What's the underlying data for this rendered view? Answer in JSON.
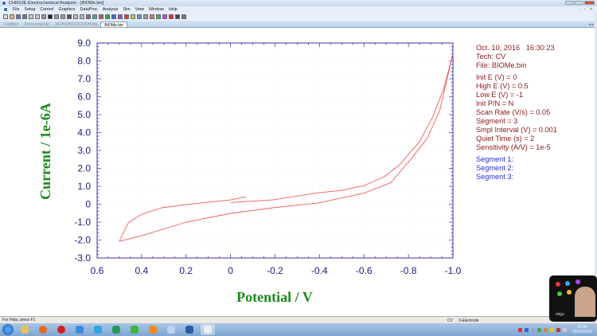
{
  "window": {
    "title": "CHI610E Electrochemical Analyzer - [BIOMe.bin]"
  },
  "menu": [
    "File",
    "Setup",
    "Control",
    "Graphics",
    "DataProc",
    "Analysis",
    "Sim",
    "View",
    "Window",
    "Help"
  ],
  "tabs": [
    {
      "label": "Untitled",
      "active": false
    },
    {
      "label": "Ferrocene.bin",
      "active": false
    },
    {
      "label": "(4-Ph)PhCF2COOH.bin",
      "active": false
    },
    {
      "label": "BIOMe.bin",
      "active": true
    }
  ],
  "info": {
    "datetime": "Oct. 10, 2016   16:30:23",
    "tech": "Tech: CV",
    "file": "File: BIOMe.bin",
    "params": [
      "Init E (V) = 0",
      "High E (V) = 0.5",
      "Low E (V) = -1",
      "Init P/N = N",
      "Scan Rate (V/s) = 0.05",
      "Segment = 3",
      "Smpl Interval (V) = 0.001",
      "Quiet Time (s) = 2",
      "Sensitivity (A/V) = 1e-5"
    ],
    "segments": [
      "Segment 1:",
      "Segment 2:",
      "Segment 3:"
    ]
  },
  "status": {
    "help": "For Help, press F1",
    "tech": "CV",
    "electrode": "3-Electrode"
  },
  "taskbar": {
    "time": "19:44",
    "date": "2016/10/10",
    "ad_brand": "migu"
  },
  "colors": {
    "axis": "#3333aa",
    "curve": "#f05a5a",
    "label": "#1a8a1a",
    "info": "#8b1a1a",
    "segment": "#2a2ae0"
  },
  "chart_data": {
    "type": "line",
    "xlabel": "Potential / V",
    "ylabel": "Current / 1e-6A",
    "xlim": [
      0.6,
      -1.0
    ],
    "ylim": [
      -3.0,
      9.0
    ],
    "xticks": [
      "0.6",
      "0.4",
      "0.2",
      "0",
      "-0.2",
      "-0.4",
      "-0.6",
      "-0.8",
      "-1.0"
    ],
    "yticks": [
      "9.0",
      "8.0",
      "7.0",
      "6.0",
      "5.0",
      "4.0",
      "3.0",
      "2.0",
      "1.0",
      "0",
      "-1.0",
      "-2.0",
      "-3.0"
    ],
    "grid": true,
    "series": [
      {
        "name": "Segment 1",
        "x": [
          0,
          -0.19,
          -0.395,
          -0.5,
          -0.6,
          -0.69,
          -0.76,
          -0.85,
          -0.91,
          -0.96,
          -1.0
        ],
        "y": [
          0.1,
          0.24,
          0.64,
          0.77,
          1.04,
          1.53,
          2.2,
          3.5,
          4.9,
          6.5,
          8.4
        ]
      },
      {
        "name": "Segment 2",
        "x": [
          -1.0,
          -0.94,
          -0.885,
          -0.81,
          -0.72,
          -0.6,
          -0.395,
          -0.19,
          0,
          0.2,
          0.4,
          0.5
        ],
        "y": [
          8.4,
          5.2,
          3.7,
          2.5,
          1.2,
          0.62,
          0.07,
          -0.2,
          -0.51,
          -1.0,
          -1.76,
          -2.07
        ]
      },
      {
        "name": "Segment 3",
        "x": [
          0.5,
          0.46,
          0.4,
          0.31,
          0.2,
          0,
          -0.07
        ],
        "y": [
          -2.07,
          -1.04,
          -0.56,
          -0.2,
          -0.02,
          0.24,
          0.42
        ]
      }
    ]
  }
}
